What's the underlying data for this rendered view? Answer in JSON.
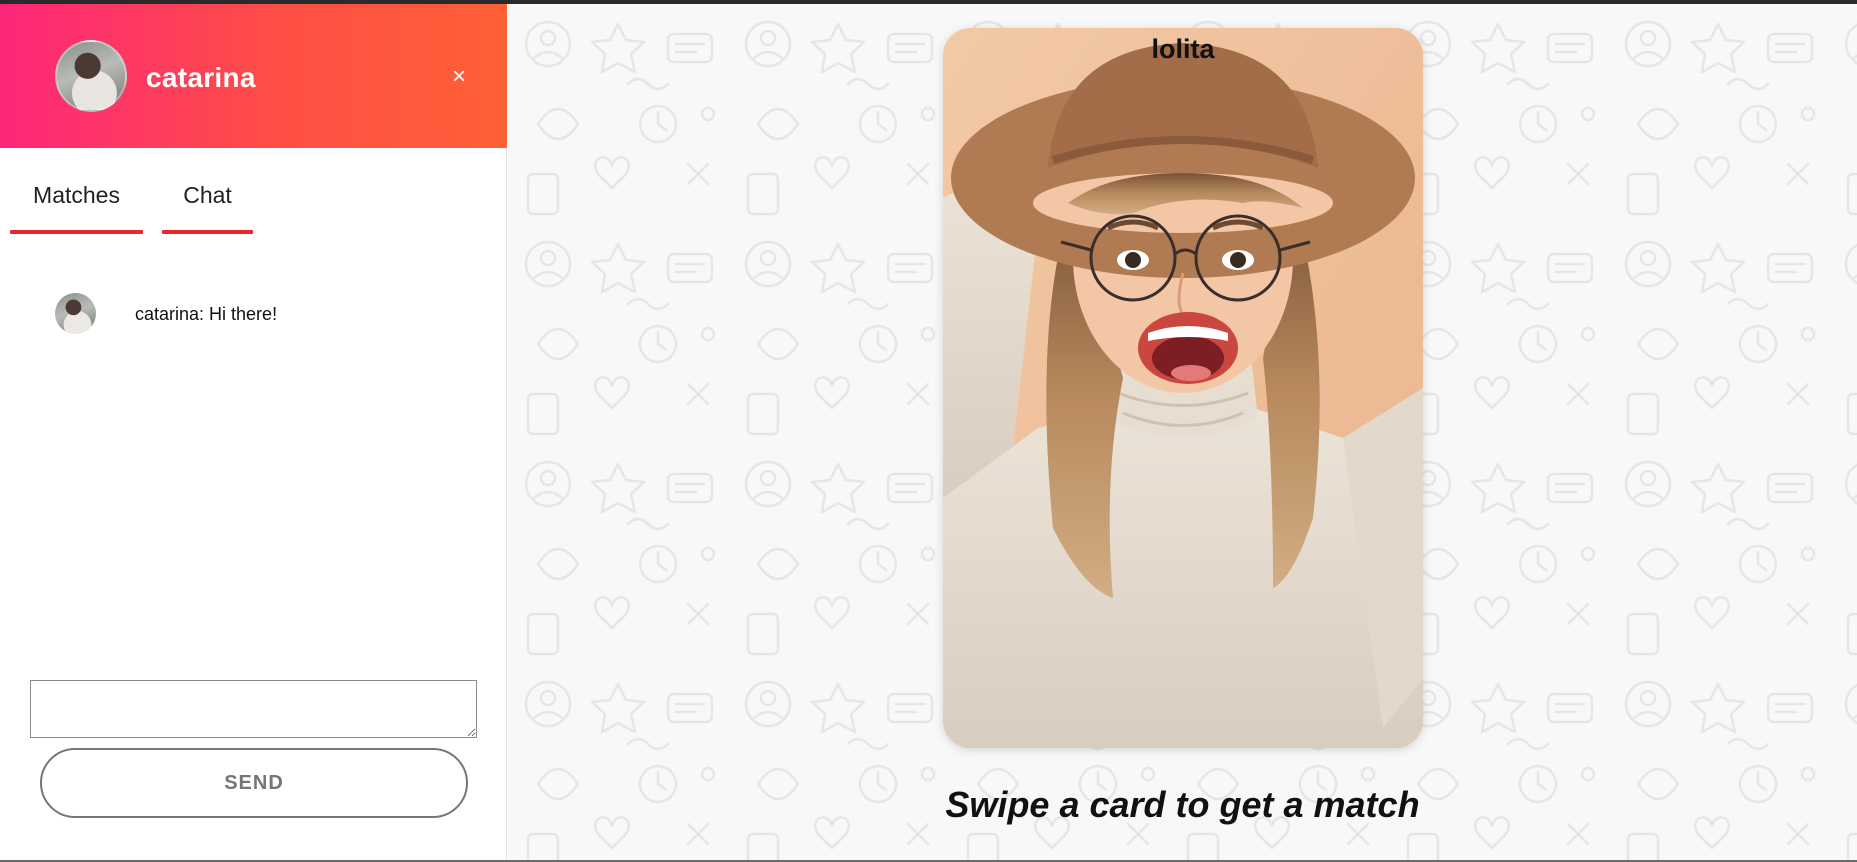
{
  "sidebar": {
    "header": {
      "name": "catarina",
      "close_label": "×"
    },
    "tabs": [
      {
        "label": "Matches"
      },
      {
        "label": "Chat"
      }
    ],
    "chats": [
      {
        "text": "catarina: Hi there!"
      }
    ],
    "message_input": {
      "value": ""
    },
    "send_label": "SEND"
  },
  "main": {
    "card": {
      "name": "lolita"
    },
    "tagline": "Swipe a card to get a match"
  },
  "colors": {
    "header_gradient_start": "#fd267a",
    "header_gradient_end": "#ff6036",
    "tab_underline": "#e8262f",
    "send_button_border": "#767676",
    "main_background": "#f8f8f8"
  },
  "icons": {
    "close": "close-icon",
    "background_pattern": "doodle-pattern"
  }
}
